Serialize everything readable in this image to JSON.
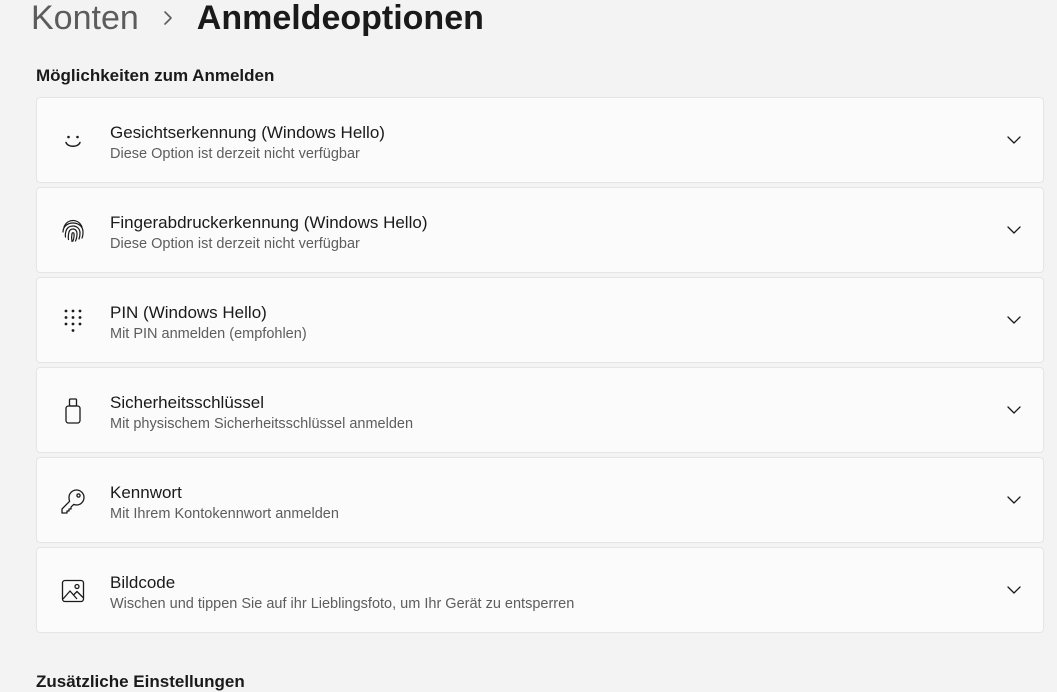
{
  "breadcrumb": {
    "parent": "Konten",
    "current": "Anmeldeoptionen"
  },
  "section_title": "Möglichkeiten zum Anmelden",
  "options": [
    {
      "title": "Gesichtserkennung (Windows Hello)",
      "subtitle": "Diese Option ist derzeit nicht verfügbar",
      "icon": "face-icon"
    },
    {
      "title": "Fingerabdruckerkennung (Windows Hello)",
      "subtitle": "Diese Option ist derzeit nicht verfügbar",
      "icon": "fingerprint-icon"
    },
    {
      "title": "PIN (Windows Hello)",
      "subtitle": "Mit PIN anmelden (empfohlen)",
      "icon": "pin-keypad-icon"
    },
    {
      "title": "Sicherheitsschlüssel",
      "subtitle": "Mit physischem Sicherheitsschlüssel anmelden",
      "icon": "security-key-icon"
    },
    {
      "title": "Kennwort",
      "subtitle": "Mit Ihrem Kontokennwort anmelden",
      "icon": "key-icon"
    },
    {
      "title": "Bildcode",
      "subtitle": "Wischen und tippen Sie auf ihr Lieblingsfoto, um Ihr Gerät zu entsperren",
      "icon": "picture-icon"
    }
  ],
  "next_section_title": "Zusätzliche Einstellungen"
}
